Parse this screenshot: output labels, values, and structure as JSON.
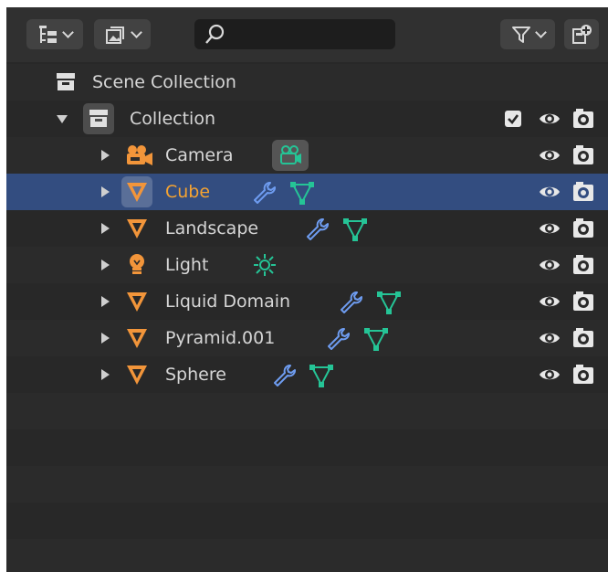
{
  "header": {
    "display_mode_icon": "outliner-tree-icon",
    "filter_icon": "funnel-icon",
    "new_collection_icon": "new-collection-icon",
    "search": {
      "value": "",
      "placeholder": ""
    }
  },
  "scene_collection": {
    "label": "Scene Collection"
  },
  "collection": {
    "label": "Collection",
    "checked": true
  },
  "objects": [
    {
      "label": "Camera",
      "type": "camera",
      "data_icon": "camera-data-icon"
    },
    {
      "label": "Cube",
      "type": "mesh",
      "selected": true,
      "modifier_icon": "wrench-icon",
      "data_icon": "mesh-data-icon"
    },
    {
      "label": "Landscape",
      "type": "mesh",
      "modifier_icon": "wrench-icon",
      "data_icon": "mesh-data-icon"
    },
    {
      "label": "Light",
      "type": "light",
      "data_icon": "sun-light-data-icon"
    },
    {
      "label": "Liquid Domain",
      "type": "mesh",
      "modifier_icon": "wrench-icon",
      "data_icon": "mesh-data-icon"
    },
    {
      "label": "Pyramid.001",
      "type": "mesh",
      "modifier_icon": "wrench-icon",
      "data_icon": "mesh-data-icon"
    },
    {
      "label": "Sphere",
      "type": "mesh",
      "modifier_icon": "wrench-icon",
      "data_icon": "mesh-data-icon"
    }
  ],
  "colors": {
    "background": "#282828",
    "selection": "#334d80",
    "selected_text": "#f5a331",
    "object_orange": "#f2953a",
    "modifier_blue": "#6e9cf0",
    "data_green": "#25c496"
  }
}
